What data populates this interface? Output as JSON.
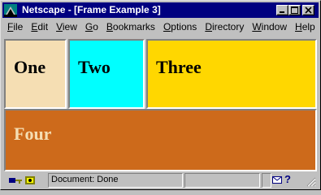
{
  "window": {
    "title": "Netscape - [Frame Example 3]"
  },
  "menu": [
    {
      "mnemonic": "F",
      "rest": "ile"
    },
    {
      "mnemonic": "E",
      "rest": "dit"
    },
    {
      "mnemonic": "V",
      "rest": "iew"
    },
    {
      "mnemonic": "G",
      "rest": "o"
    },
    {
      "mnemonic": "B",
      "rest": "ookmarks"
    },
    {
      "mnemonic": "O",
      "rest": "ptions"
    },
    {
      "mnemonic": "D",
      "rest": "irectory"
    },
    {
      "mnemonic": "W",
      "rest": "indow"
    },
    {
      "mnemonic": "H",
      "rest": "elp"
    }
  ],
  "frames": {
    "one": {
      "label": "One",
      "color": "#f5deb3"
    },
    "two": {
      "label": "Two",
      "color": "#00ffff"
    },
    "three": {
      "label": "Three",
      "color": "#ffd700"
    },
    "four": {
      "label": "Four",
      "color": "#cd6a1b",
      "text_color": "#f5deb3"
    }
  },
  "status": {
    "text": "Document: Done",
    "icons": [
      "security-key-icon",
      "online-connection-icon",
      "mail-icon",
      "help-icon",
      "resize-grip-icon"
    ]
  }
}
